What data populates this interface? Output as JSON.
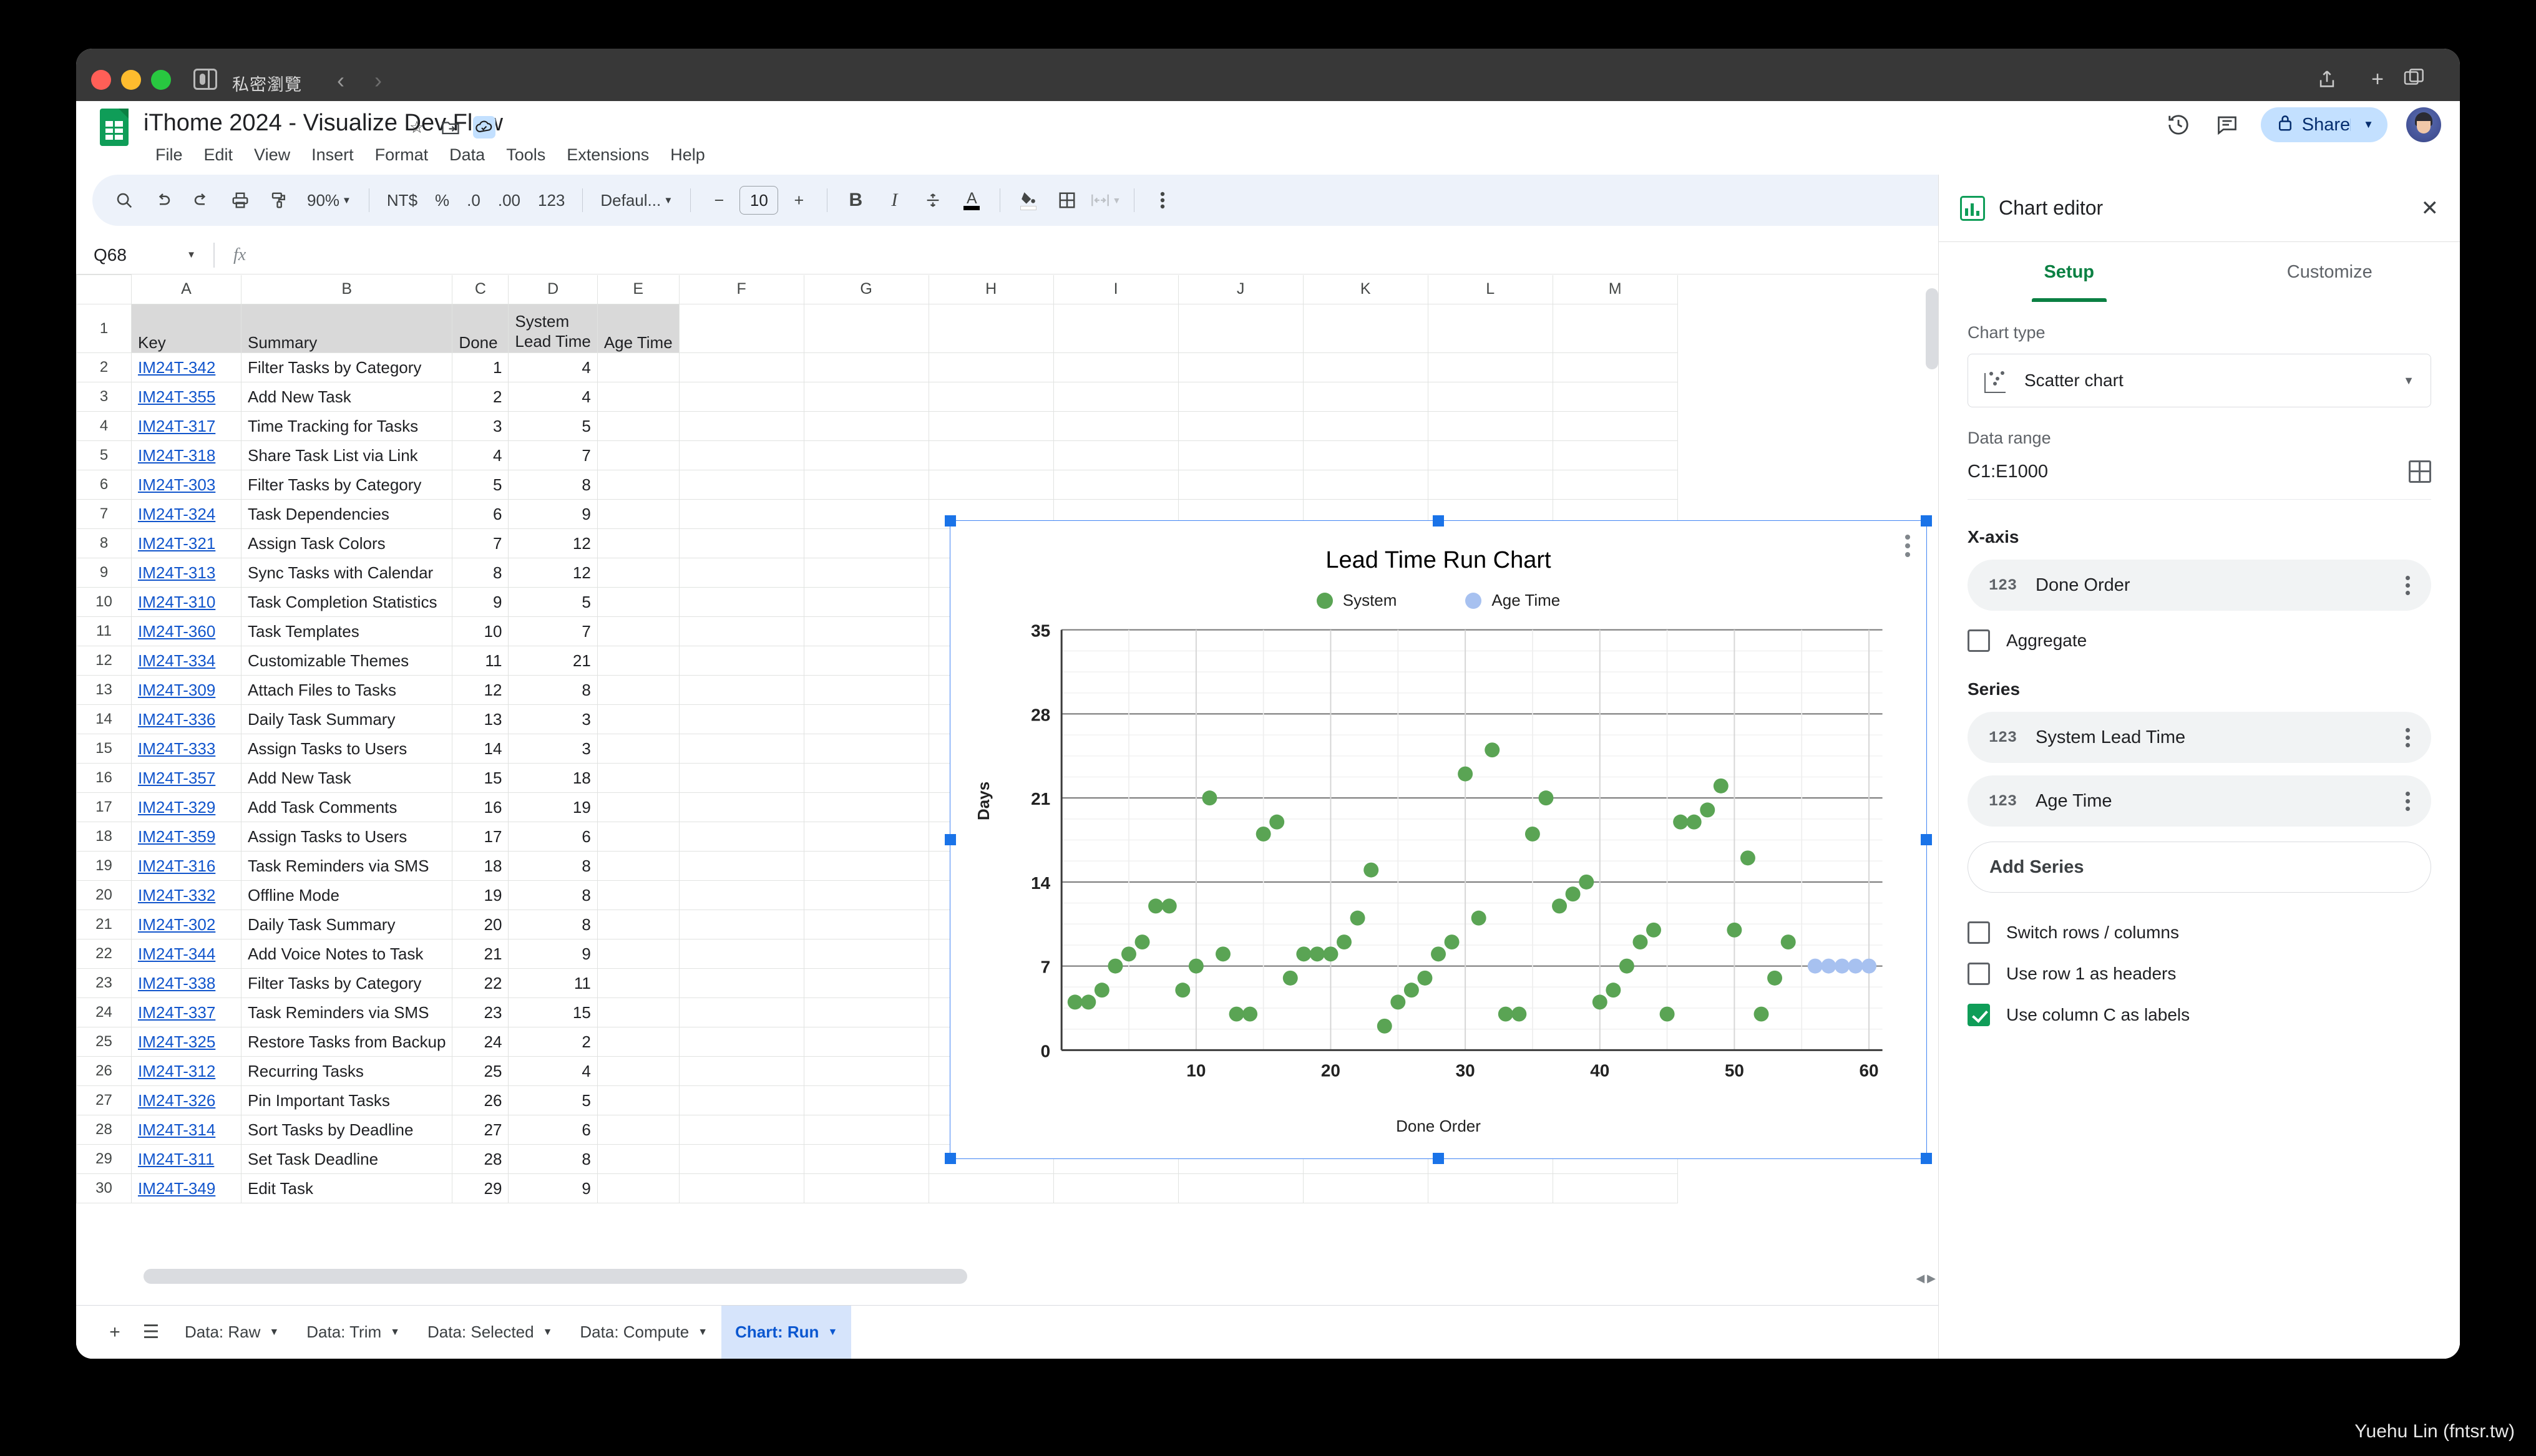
{
  "browser": {
    "private_label": "私密瀏覽",
    "back_icon": "chevron-left-icon",
    "forward_icon": "chevron-right-icon",
    "share_icon": "share-icon",
    "newtab_icon": "plus-icon",
    "tabs_icon": "tab-overview-icon"
  },
  "header": {
    "doc_title": "iThome 2024 - Visualize Dev Flow",
    "star_icon": "star-icon",
    "move_icon": "move-to-folder-icon",
    "cloud_icon": "cloud-saved-icon",
    "menus": [
      "File",
      "Edit",
      "View",
      "Insert",
      "Format",
      "Data",
      "Tools",
      "Extensions",
      "Help"
    ],
    "history_icon": "version-history-icon",
    "comment_icon": "comment-icon",
    "share_label": "Share",
    "share_lock_icon": "lock-icon",
    "share_caret_icon": "chevron-down-icon",
    "avatar_icon": "user-avatar"
  },
  "toolbar": {
    "search_icon": "search-icon",
    "undo_icon": "undo-icon",
    "redo_icon": "redo-icon",
    "print_icon": "print-icon",
    "paint_icon": "paint-format-icon",
    "zoom": "90%",
    "currency": "NT$",
    "percent": "%",
    "decrease_decimal": ".0",
    "increase_decimal": ".00",
    "number_format": "123",
    "font": "Defaul...",
    "font_decrease": "−",
    "font_size": "10",
    "font_increase": "+",
    "bold": "B",
    "italic": "I",
    "strikethrough": "S",
    "text_color": "A",
    "fill_color_icon": "fill-color-icon",
    "borders_icon": "borders-icon",
    "merge_icon": "merge-cells-icon",
    "more_icon": "more-options-icon",
    "collapse_icon": "collapse-toolbar-icon"
  },
  "namebar": {
    "cell_ref": "Q68",
    "caret_icon": "chevron-down-icon",
    "fx_icon": "fx-icon",
    "formula_value": ""
  },
  "grid": {
    "columns": [
      "A",
      "B",
      "C",
      "D",
      "E",
      "F",
      "G",
      "H",
      "I",
      "J",
      "K",
      "L",
      "M"
    ],
    "header_row": {
      "num": "1",
      "key": "Key",
      "summary": "Summary",
      "done": "Done",
      "lead": "System Lead Time",
      "lead_l1": "System",
      "lead_l2": "Lead Time",
      "age": "Age Time"
    },
    "rows": [
      {
        "n": "2",
        "key": "IM24T-342",
        "summary": "Filter Tasks by Category",
        "done": "1",
        "lead": "4",
        "age": ""
      },
      {
        "n": "3",
        "key": "IM24T-355",
        "summary": "Add New Task",
        "done": "2",
        "lead": "4",
        "age": ""
      },
      {
        "n": "4",
        "key": "IM24T-317",
        "summary": "Time Tracking for Tasks",
        "done": "3",
        "lead": "5",
        "age": ""
      },
      {
        "n": "5",
        "key": "IM24T-318",
        "summary": "Share Task List via Link",
        "done": "4",
        "lead": "7",
        "age": ""
      },
      {
        "n": "6",
        "key": "IM24T-303",
        "summary": "Filter Tasks by Category",
        "done": "5",
        "lead": "8",
        "age": ""
      },
      {
        "n": "7",
        "key": "IM24T-324",
        "summary": "Task Dependencies",
        "done": "6",
        "lead": "9",
        "age": ""
      },
      {
        "n": "8",
        "key": "IM24T-321",
        "summary": "Assign Task Colors",
        "done": "7",
        "lead": "12",
        "age": ""
      },
      {
        "n": "9",
        "key": "IM24T-313",
        "summary": "Sync Tasks with Calendar",
        "done": "8",
        "lead": "12",
        "age": ""
      },
      {
        "n": "10",
        "key": "IM24T-310",
        "summary": "Task Completion Statistics",
        "done": "9",
        "lead": "5",
        "age": ""
      },
      {
        "n": "11",
        "key": "IM24T-360",
        "summary": "Task Templates",
        "done": "10",
        "lead": "7",
        "age": ""
      },
      {
        "n": "12",
        "key": "IM24T-334",
        "summary": "Customizable Themes",
        "done": "11",
        "lead": "21",
        "age": ""
      },
      {
        "n": "13",
        "key": "IM24T-309",
        "summary": "Attach Files to Tasks",
        "done": "12",
        "lead": "8",
        "age": ""
      },
      {
        "n": "14",
        "key": "IM24T-336",
        "summary": "Daily Task Summary",
        "done": "13",
        "lead": "3",
        "age": ""
      },
      {
        "n": "15",
        "key": "IM24T-333",
        "summary": "Assign Tasks to Users",
        "done": "14",
        "lead": "3",
        "age": ""
      },
      {
        "n": "16",
        "key": "IM24T-357",
        "summary": "Add New Task",
        "done": "15",
        "lead": "18",
        "age": ""
      },
      {
        "n": "17",
        "key": "IM24T-329",
        "summary": "Add Task Comments",
        "done": "16",
        "lead": "19",
        "age": ""
      },
      {
        "n": "18",
        "key": "IM24T-359",
        "summary": "Assign Tasks to Users",
        "done": "17",
        "lead": "6",
        "age": ""
      },
      {
        "n": "19",
        "key": "IM24T-316",
        "summary": "Task Reminders via SMS",
        "done": "18",
        "lead": "8",
        "age": ""
      },
      {
        "n": "20",
        "key": "IM24T-332",
        "summary": "Offline Mode",
        "done": "19",
        "lead": "8",
        "age": ""
      },
      {
        "n": "21",
        "key": "IM24T-302",
        "summary": "Daily Task Summary",
        "done": "20",
        "lead": "8",
        "age": ""
      },
      {
        "n": "22",
        "key": "IM24T-344",
        "summary": "Add Voice Notes to Task",
        "done": "21",
        "lead": "9",
        "age": ""
      },
      {
        "n": "23",
        "key": "IM24T-338",
        "summary": "Filter Tasks by Category",
        "done": "22",
        "lead": "11",
        "age": ""
      },
      {
        "n": "24",
        "key": "IM24T-337",
        "summary": "Task Reminders via SMS",
        "done": "23",
        "lead": "15",
        "age": ""
      },
      {
        "n": "25",
        "key": "IM24T-325",
        "summary": "Restore Tasks from Backup",
        "done": "24",
        "lead": "2",
        "age": ""
      },
      {
        "n": "26",
        "key": "IM24T-312",
        "summary": "Recurring Tasks",
        "done": "25",
        "lead": "4",
        "age": ""
      },
      {
        "n": "27",
        "key": "IM24T-326",
        "summary": "Pin Important Tasks",
        "done": "26",
        "lead": "5",
        "age": ""
      },
      {
        "n": "28",
        "key": "IM24T-314",
        "summary": "Sort Tasks by Deadline",
        "done": "27",
        "lead": "6",
        "age": ""
      },
      {
        "n": "29",
        "key": "IM24T-311",
        "summary": "Set Task Deadline",
        "done": "28",
        "lead": "8",
        "age": ""
      },
      {
        "n": "30",
        "key": "IM24T-349",
        "summary": "Edit Task",
        "done": "29",
        "lead": "9",
        "age": ""
      }
    ]
  },
  "sheetbar": {
    "add_icon": "add-sheet-icon",
    "list_icon": "all-sheets-icon",
    "tabs": [
      {
        "label": "Data: Raw",
        "active": false
      },
      {
        "label": "Data: Trim",
        "active": false
      },
      {
        "label": "Data: Selected",
        "active": false
      },
      {
        "label": "Data: Compute",
        "active": false
      },
      {
        "label": "Chart: Run",
        "active": true
      }
    ],
    "collapse_icon": "collapse-sidebar-icon"
  },
  "editor": {
    "icon": "chart-editor-icon",
    "title": "Chart editor",
    "close_icon": "close-icon",
    "tabs": [
      {
        "label": "Setup",
        "active": true
      },
      {
        "label": "Customize",
        "active": false
      }
    ],
    "chart_type_label": "Chart type",
    "chart_type_value": "Scatter chart",
    "chart_type_icon": "scatter-chart-icon",
    "chart_type_caret": "chevron-down-icon",
    "data_range_label": "Data range",
    "data_range_value": "C1:E1000",
    "range_picker_icon": "select-range-icon",
    "x_axis_label": "X-axis",
    "x_axis_field": "Done Order",
    "aggregate_label": "Aggregate",
    "aggregate_checked": false,
    "series_label": "Series",
    "series": [
      "System Lead Time",
      "Age Time"
    ],
    "add_series_label": "Add Series",
    "options": [
      {
        "label": "Switch rows / columns",
        "checked": false
      },
      {
        "label": "Use row 1 as headers",
        "checked": false
      },
      {
        "label": "Use column C as labels",
        "checked": true
      }
    ]
  },
  "chart_data": {
    "type": "scatter",
    "title": "Lead Time Run Chart",
    "xlabel": "Done Order",
    "ylabel": "Days",
    "xlim": [
      0,
      61
    ],
    "ylim": [
      0,
      35
    ],
    "xticks": [
      10,
      20,
      30,
      40,
      50,
      60
    ],
    "yticks": [
      0,
      7,
      14,
      21,
      28,
      35
    ],
    "grid": true,
    "legend_position": "top-center",
    "menu_icon": "chart-more-icon",
    "series": [
      {
        "name": "System",
        "color": "#5aa454",
        "x": [
          1,
          2,
          3,
          4,
          5,
          6,
          7,
          8,
          9,
          10,
          11,
          12,
          13,
          14,
          15,
          16,
          17,
          18,
          19,
          20,
          21,
          22,
          23,
          24,
          25,
          26,
          27,
          28,
          29,
          30,
          31,
          32,
          33,
          34,
          35,
          36,
          37,
          38,
          39,
          40,
          41,
          42,
          43,
          44,
          45,
          46,
          47,
          48,
          49,
          50,
          51,
          52,
          53,
          54
        ],
        "y": [
          4,
          4,
          5,
          7,
          8,
          9,
          12,
          12,
          5,
          7,
          21,
          8,
          3,
          3,
          18,
          19,
          6,
          8,
          8,
          8,
          9,
          11,
          15,
          2,
          4,
          5,
          6,
          8,
          9,
          23,
          11,
          25,
          3,
          3,
          18,
          21,
          12,
          13,
          14,
          4,
          5,
          7,
          9,
          10,
          3,
          19,
          19,
          20,
          22,
          10,
          16,
          3,
          6,
          9
        ]
      },
      {
        "name": "Age Time",
        "color": "#a7c1f0",
        "x": [
          56,
          57,
          58,
          59,
          60
        ],
        "y": [
          7,
          7,
          7,
          7,
          7
        ]
      }
    ]
  },
  "watermark": "Yuehu Lin (fntsr.tw)"
}
